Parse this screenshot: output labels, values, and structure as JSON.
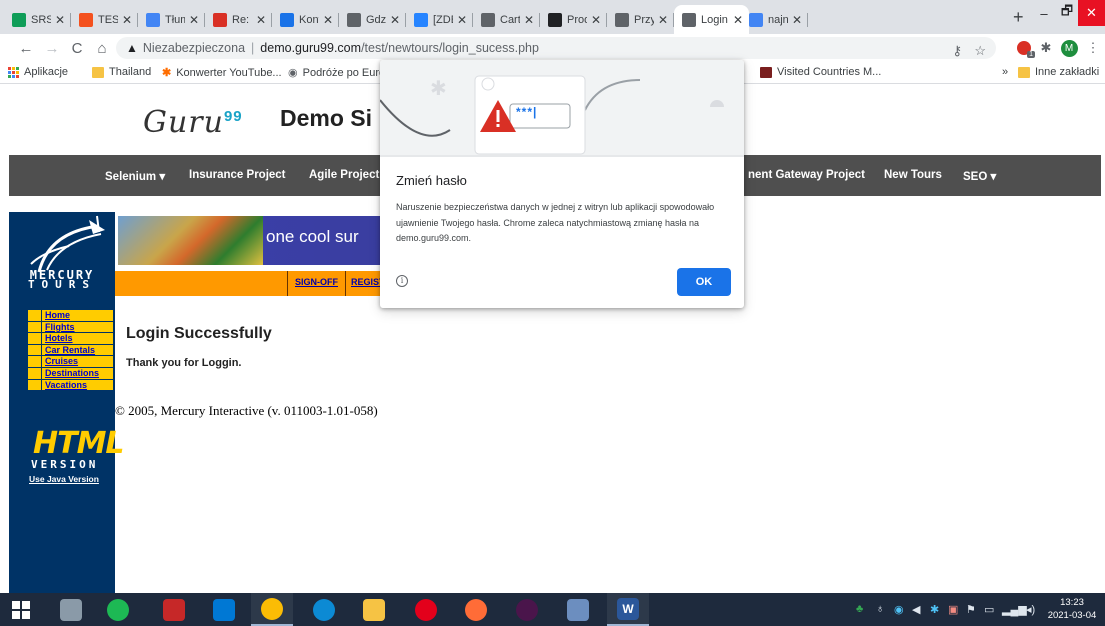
{
  "browser": {
    "tabs": [
      {
        "title": "SRS_v",
        "icon": "sheets-icon",
        "color": "#0f9d58"
      },
      {
        "title": "TEST F",
        "icon": "test-icon",
        "color": "#f4511e"
      },
      {
        "title": "Tłuma",
        "icon": "translate-icon",
        "color": "#4285f4"
      },
      {
        "title": "Re: ZD",
        "icon": "gmail-icon",
        "color": "#d93025"
      },
      {
        "title": "Konfe",
        "icon": "q-icon",
        "color": "#1a73e8"
      },
      {
        "title": "Gdzie",
        "icon": "gdzie-icon",
        "color": "#5f6368"
      },
      {
        "title": "[ZDES",
        "icon": "jira-icon",
        "color": "#2684ff"
      },
      {
        "title": "Cart It",
        "icon": "globe-icon",
        "color": "#5f6368"
      },
      {
        "title": "Produ",
        "icon": "bl-icon",
        "color": "#202124"
      },
      {
        "title": "Przykł",
        "icon": "globe-icon",
        "color": "#5f6368"
      },
      {
        "title": "Login",
        "icon": "globe-icon",
        "color": "#5f6368"
      },
      {
        "title": "najnow",
        "icon": "google-icon",
        "color": "#4285f4"
      }
    ],
    "new_tab": "+",
    "window_controls": {
      "minimize": "–",
      "restore": "🗗",
      "close": "✕"
    },
    "security_label": "Niezabezpieczona",
    "url_host": "demo.guru99.com",
    "url_path": "/test/newtours/login_sucess.php",
    "bookmarks": [
      {
        "label": "Aplikacje",
        "color": "#e37400"
      },
      {
        "label": "Thailand",
        "color": "#f6c344"
      },
      {
        "label": "Konwerter YouTube...",
        "color": "#ff6d00"
      },
      {
        "label": "Podróże po Europ",
        "color": "#9aa0a6"
      },
      {
        "label": "Visited Countries M...",
        "color": "#7a1f1f"
      }
    ],
    "bookmarks_more": "»",
    "other_bookmarks": "Inne zakładki",
    "profile_letter": "M",
    "extension_badge": "1"
  },
  "site": {
    "logo_text": "Guru",
    "logo_sup": "99",
    "title": "Demo Si",
    "nav": [
      {
        "label": "Selenium ▾"
      },
      {
        "label": "Insurance Project"
      },
      {
        "label": "Agile Project"
      },
      {
        "label": "nent Gateway Project"
      },
      {
        "label": "New Tours"
      },
      {
        "label": "SEO ▾"
      }
    ]
  },
  "mercury": {
    "name_line1": "MERCURY",
    "name_line2": "TOURS",
    "banner_text": "one cool sur",
    "orange_links": [
      "SIGN-OFF",
      "REGIST"
    ],
    "menu": [
      "Home",
      "Flights",
      "Hotels",
      "Car Rentals",
      "Cruises",
      "Destinations",
      "Vacations"
    ],
    "html_logo": "HTML",
    "version_label": "VERSION",
    "java_link": "Use Java Version",
    "heading": "Login Successfully",
    "thanks": "Thank you for Loggin.",
    "copyright": "© 2005, Mercury Interactive (v. 011003-1.01-058)"
  },
  "dialog": {
    "password_mask": "***|",
    "title": "Zmień hasło",
    "body": "Naruszenie bezpieczeństwa danych w jednej z witryn lub aplikacji spowodowało ujawnienie Twojego hasła. Chrome zaleca natychmiastową zmianę hasła na demo.guru99.com.",
    "info_symbol": "i",
    "ok_label": "OK"
  },
  "taskbar": {
    "apps": [
      {
        "name": "start",
        "color": "#ffffff",
        "glyph": ""
      },
      {
        "name": "cleanup",
        "color": "#8a9aa8",
        "glyph": ""
      },
      {
        "name": "spotify",
        "color": "#1db954",
        "glyph": ""
      },
      {
        "name": "furmark",
        "color": "#c62828",
        "glyph": ""
      },
      {
        "name": "store",
        "color": "#0078d4",
        "glyph": ""
      },
      {
        "name": "chrome",
        "color": "#fbbc05",
        "glyph": ""
      },
      {
        "name": "edge",
        "color": "#0c8ad4",
        "glyph": ""
      },
      {
        "name": "explorer",
        "color": "#f6c344",
        "glyph": ""
      },
      {
        "name": "opera",
        "color": "#e3001b",
        "glyph": ""
      },
      {
        "name": "postman",
        "color": "#ff6c37",
        "glyph": ""
      },
      {
        "name": "slack",
        "color": "#4a154b",
        "glyph": ""
      },
      {
        "name": "paint",
        "color": "#6c8ebf",
        "glyph": ""
      },
      {
        "name": "word",
        "color": "#2b579a",
        "glyph": "W"
      }
    ],
    "time": "13:23",
    "date": "2021-03-04"
  }
}
